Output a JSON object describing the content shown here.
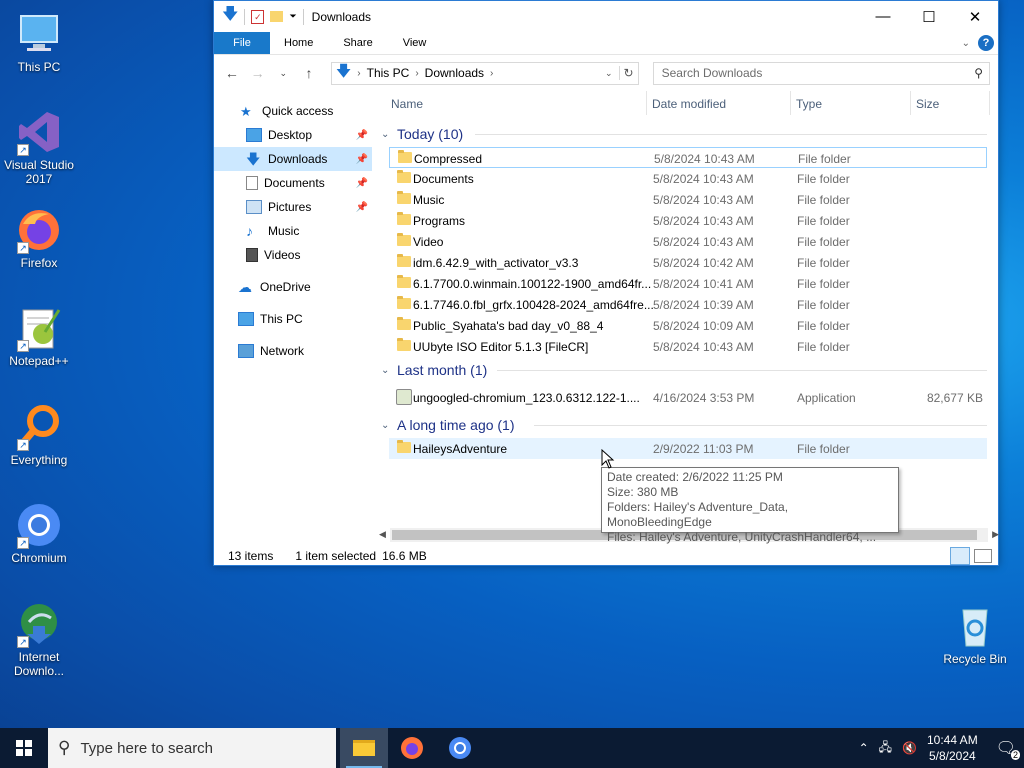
{
  "desktop": {
    "icons": [
      {
        "label": "This PC",
        "icon": "monitor-icon"
      },
      {
        "label": "Visual Studio 2017",
        "icon": "visual-studio-icon"
      },
      {
        "label": "Firefox",
        "icon": "firefox-icon"
      },
      {
        "label": "Notepad++",
        "icon": "notepadpp-icon"
      },
      {
        "label": "Everything",
        "icon": "everything-icon"
      },
      {
        "label": "Chromium",
        "icon": "chromium-icon"
      },
      {
        "label": "Internet Downlo...",
        "icon": "idm-icon"
      },
      {
        "label": "Recycle Bin",
        "icon": "recycle-bin-icon"
      }
    ]
  },
  "window": {
    "title": "Downloads",
    "ribbon": {
      "file": "File",
      "tabs": [
        "Home",
        "Share",
        "View"
      ],
      "help": "?"
    },
    "address": {
      "path": [
        "This PC",
        "Downloads"
      ]
    },
    "search": {
      "placeholder": "Search Downloads"
    },
    "nav": {
      "quick_access": "Quick access",
      "items": [
        {
          "label": "Desktop",
          "pinned": true
        },
        {
          "label": "Downloads",
          "pinned": true,
          "selected": true
        },
        {
          "label": "Documents",
          "pinned": true
        },
        {
          "label": "Pictures",
          "pinned": true
        },
        {
          "label": "Music",
          "pinned": false
        },
        {
          "label": "Videos",
          "pinned": false
        }
      ],
      "onedrive": "OneDrive",
      "thispc": "This PC",
      "network": "Network"
    },
    "columns": {
      "name": "Name",
      "modified": "Date modified",
      "type": "Type",
      "size": "Size"
    },
    "groups": [
      {
        "title": "Today (10)",
        "rows": [
          {
            "name": "Compressed",
            "modified": "5/8/2024 10:43 AM",
            "type": "File folder",
            "size": ""
          },
          {
            "name": "Documents",
            "modified": "5/8/2024 10:43 AM",
            "type": "File folder",
            "size": ""
          },
          {
            "name": "Music",
            "modified": "5/8/2024 10:43 AM",
            "type": "File folder",
            "size": ""
          },
          {
            "name": "Programs",
            "modified": "5/8/2024 10:43 AM",
            "type": "File folder",
            "size": ""
          },
          {
            "name": "Video",
            "modified": "5/8/2024 10:43 AM",
            "type": "File folder",
            "size": ""
          },
          {
            "name": "idm.6.42.9_with_activator_v3.3",
            "modified": "5/8/2024 10:42 AM",
            "type": "File folder",
            "size": ""
          },
          {
            "name": "6.1.7700.0.winmain.100122-1900_amd64fr...",
            "modified": "5/8/2024 10:41 AM",
            "type": "File folder",
            "size": ""
          },
          {
            "name": "6.1.7746.0.fbl_grfx.100428-2024_amd64fre...",
            "modified": "5/8/2024 10:39 AM",
            "type": "File folder",
            "size": ""
          },
          {
            "name": "Public_Syahata's bad day_v0_88_4",
            "modified": "5/8/2024 10:09 AM",
            "type": "File folder",
            "size": ""
          },
          {
            "name": "UUbyte ISO Editor 5.1.3 [FileCR]",
            "modified": "5/8/2024 10:43 AM",
            "type": "File folder",
            "size": ""
          }
        ]
      },
      {
        "title": "Last month (1)",
        "rows": [
          {
            "name": "ungoogled-chromium_123.0.6312.122-1....",
            "modified": "4/16/2024 3:53 PM",
            "type": "Application",
            "size": "82,677 KB"
          }
        ]
      },
      {
        "title": "A long time ago (1)",
        "rows": [
          {
            "name": "HaileysAdventure",
            "modified": "2/9/2022 11:03 PM",
            "type": "File folder",
            "size": ""
          }
        ]
      }
    ],
    "tooltip": [
      "Date created: 2/6/2022 11:25 PM",
      "Size: 380 MB",
      "Folders: Hailey's Adventure_Data, MonoBleedingEdge",
      "Files: Hailey's Adventure, UnityCrashHandler64, ..."
    ],
    "status": {
      "items": "13 items",
      "selected": "1 item selected",
      "size": "16.6 MB"
    }
  },
  "taskbar": {
    "search_placeholder": "Type here to search",
    "time": "10:44 AM",
    "date": "5/8/2024",
    "notification_count": "2"
  }
}
